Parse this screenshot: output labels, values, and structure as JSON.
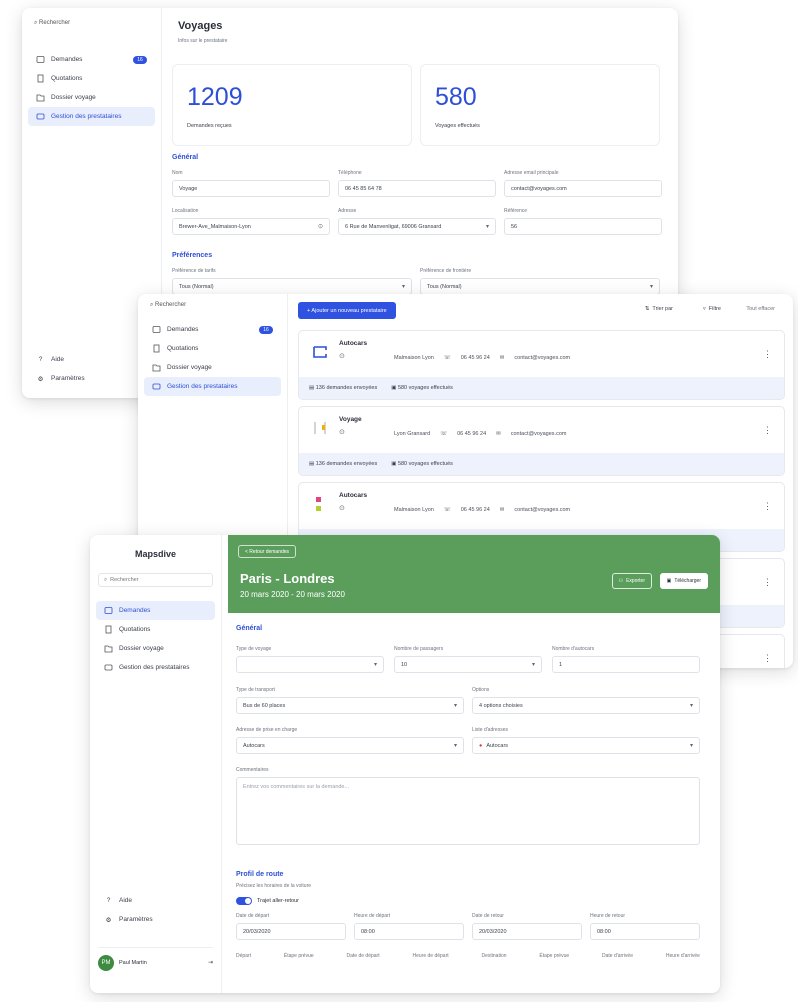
{
  "brand": "Mapsdive",
  "search_placeholder": "Rechercher",
  "nav": {
    "requests": "Demandes",
    "quotes": "Quotations",
    "travel_file": "Dossier voyage",
    "providers": "Gestion des prestataires",
    "help": "Aide",
    "settings": "Paramètres",
    "requests_badge": "16"
  },
  "w1": {
    "title": "Voyages",
    "subtitle": "Infos sur le prestataire",
    "stats": [
      {
        "value": "1209",
        "label": "Demandes reçues"
      },
      {
        "value": "580",
        "label": "Voyages effectués"
      }
    ],
    "general_title": "Général",
    "fields_row1": [
      {
        "label": "Nom",
        "value": "Voyage"
      },
      {
        "label": "Téléphone",
        "value": "06 45 85 64 78"
      },
      {
        "label": "Adresse email principale",
        "value": "contact@voyages.com"
      }
    ],
    "fields_row2": [
      {
        "label": "Localisation",
        "value": "Brewer-Ave_Malmaison-Lyon"
      },
      {
        "label": "Adresse",
        "value": "6 Rue de Manvenligat, 69006 Gransard"
      },
      {
        "label": "Référence",
        "value": "56"
      }
    ],
    "prefs_title": "Préférences",
    "prefs": [
      {
        "label": "Préférence de tarifs",
        "value": "Tous (Normal)"
      },
      {
        "label": "Préférence de frontière",
        "value": "Tous (Normal)"
      }
    ]
  },
  "w2": {
    "add_button": "+ Ajouter un nouveau prestataire",
    "sort": "Trier par",
    "filter": "Filtre",
    "clear": "Tout effacer",
    "cards": [
      {
        "name": "Autocars",
        "location": "Malmaison Lyon",
        "phone": "06 45 96 24",
        "email": "contact@voyages.com",
        "requests": "136 demandes envoyées",
        "trips": "580 voyages effectués"
      },
      {
        "name": "Voyage",
        "location": "Lyon Gransard",
        "phone": "06 45 96 24",
        "email": "contact@voyages.com",
        "requests": "136 demandes envoyées",
        "trips": "580 voyages effectués"
      },
      {
        "name": "Autocars",
        "location": "Malmaison Lyon",
        "phone": "06 45 96 24",
        "email": "contact@voyages.com",
        "requests": "",
        "trips": ""
      }
    ]
  },
  "w3": {
    "back": "< Retour demandes",
    "route": "Paris - Londres",
    "dates": "20 mars 2020 - 20 mars 2020",
    "export_btn": "Exporter",
    "download_btn": "Télécharger",
    "general_title": "Général",
    "row1": [
      {
        "label": "Type de voyage",
        "value": ""
      },
      {
        "label": "Nombre de passagers",
        "value": "10"
      },
      {
        "label": "Nombre d'autocars",
        "value": "1"
      }
    ],
    "row2": [
      {
        "label": "Type de transport",
        "value": "Bus de 60 places"
      },
      {
        "label": "Options",
        "value": "4 options choisies"
      }
    ],
    "row3": [
      {
        "label": "Adresse de prise en charge",
        "value": "Autocars"
      },
      {
        "label": "Liste d'adresses",
        "value": "Autocars"
      }
    ],
    "comments_label": "Commentaires",
    "comments_placeholder": "Entrez vos commentaires sur la demande...",
    "route_title": "Profil de route",
    "route_sub": "Précisez les horaires de la voiture",
    "return_toggle": "Trajet aller-retour",
    "route_row": [
      {
        "label": "Date de départ",
        "value": "20/03/2020"
      },
      {
        "label": "Heure de départ",
        "value": "08:00"
      },
      {
        "label": "Date de retour",
        "value": "20/03/2020"
      },
      {
        "label": "Heure de retour",
        "value": "08:00"
      }
    ],
    "route_headers": [
      "Départ",
      "Étape prévue",
      "Date de départ",
      "Heure de départ",
      "Destination",
      "Étape prévue",
      "Date d'arrivée",
      "Heure d'arrivée"
    ],
    "user_name": "Paul Martin",
    "user_initials": "PM"
  },
  "colors": {
    "accent": "#2d4fd6",
    "hero_green": "#5b9e5c"
  }
}
